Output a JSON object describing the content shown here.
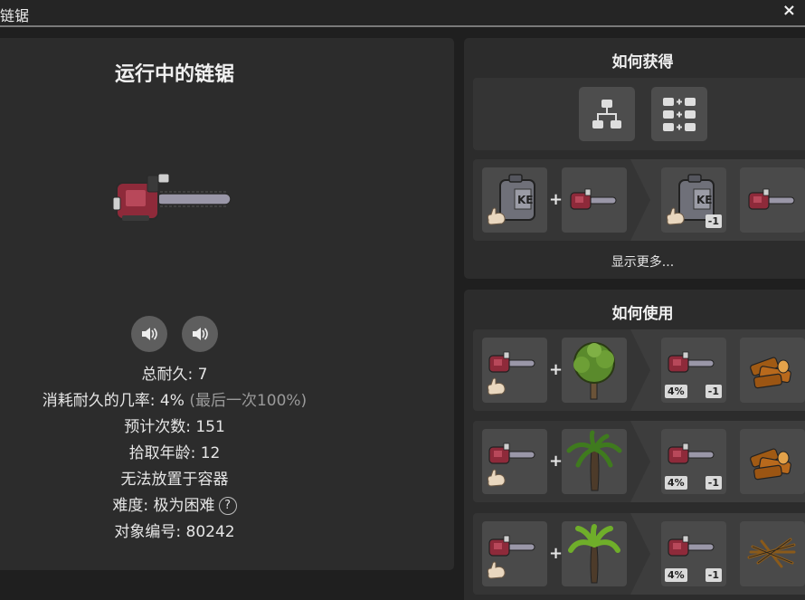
{
  "window": {
    "title": "链锯",
    "close_label": "×"
  },
  "object": {
    "title": "运行中的链锯",
    "durability": "总耐久: 7",
    "wear_chance": "消耗耐久的几率: 4%",
    "wear_chance_note": "(最后一次100%)",
    "estimated_uses": "预计次数: 151",
    "pickup_age": "拾取年龄: 12",
    "container": "无法放置于容器",
    "difficulty": "难度: 极为困难",
    "difficulty_help": "?",
    "object_id": "对象编号: 80242"
  },
  "obtain": {
    "title": "如何获得",
    "show_more": "显示更多...",
    "recipe": {
      "plus": "+",
      "result_badge": "-1"
    }
  },
  "use": {
    "title": "如何使用",
    "recipes": [
      {
        "plus": "+",
        "chance": "4%",
        "count": "-1"
      },
      {
        "plus": "+",
        "chance": "4%",
        "count": "-1"
      },
      {
        "plus": "+",
        "chance": "4%",
        "count": "-1"
      }
    ]
  },
  "colors": {
    "background": "#1f1f1f",
    "panel": "#2c2c2c",
    "slot": "#4a4a4a",
    "saw_body": "#8e2a3a",
    "bar": "#9a97a8"
  },
  "icons": [
    "speaker-icon",
    "tech-tree-icon",
    "recipe-grid-icon",
    "gas-can-icon",
    "chainsaw-icon",
    "hand-icon",
    "tree-icon",
    "palm-tree-icon",
    "banana-tree-icon",
    "firewood-icon",
    "kindling-icon"
  ]
}
